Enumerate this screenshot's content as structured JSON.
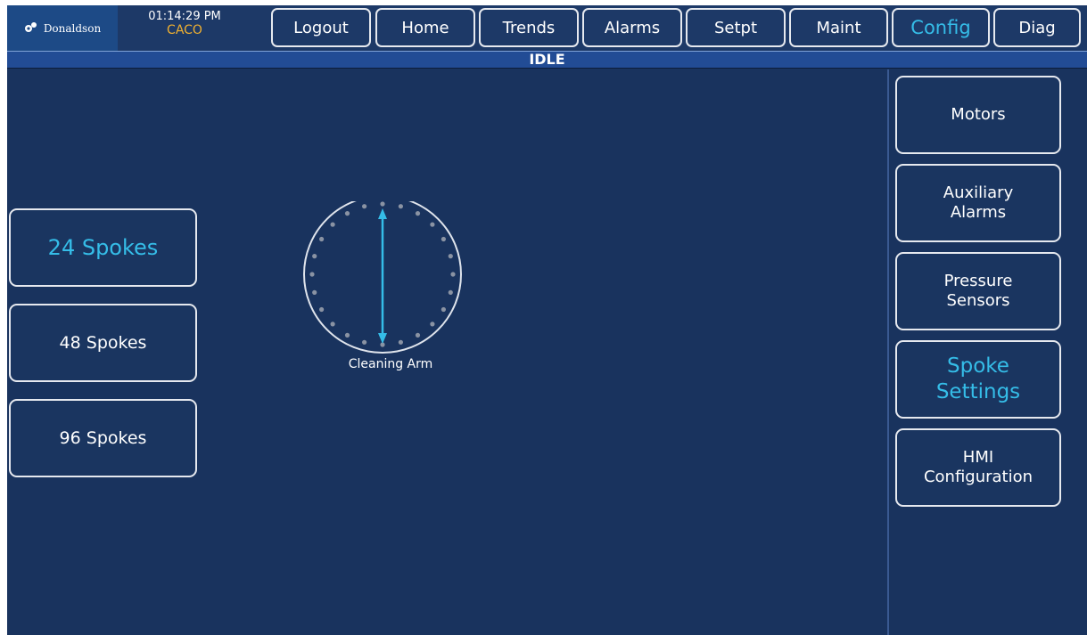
{
  "header": {
    "logo_text": "Donaldson",
    "time": "01:14:29 PM",
    "user": "CACO"
  },
  "nav": {
    "logout": "Logout",
    "home": "Home",
    "trends": "Trends",
    "alarms": "Alarms",
    "setpt": "Setpt",
    "maint": "Maint",
    "config": "Config",
    "diag": "Diag",
    "active": "Config"
  },
  "status": {
    "text": "IDLE"
  },
  "spoke_options": [
    {
      "label": "24 Spokes",
      "selected": true
    },
    {
      "label": "48 Spokes",
      "selected": false
    },
    {
      "label": "96 Spokes",
      "selected": false
    }
  ],
  "dial": {
    "caption": "Cleaning Arm",
    "spoke_count": 24
  },
  "side_menu": [
    {
      "label_lines": [
        "Motors"
      ],
      "active": false
    },
    {
      "label_lines": [
        "Auxiliary",
        "Alarms"
      ],
      "active": false
    },
    {
      "label_lines": [
        "Pressure",
        "Sensors"
      ],
      "active": false
    },
    {
      "label_lines": [
        "Spoke",
        "Settings"
      ],
      "active": true
    },
    {
      "label_lines": [
        "HMI",
        "Configuration"
      ],
      "active": false
    }
  ],
  "colors": {
    "background": "#19335e",
    "accent": "#35bde8",
    "user_text": "#f0b030",
    "button_border": "#e6e9ef"
  }
}
